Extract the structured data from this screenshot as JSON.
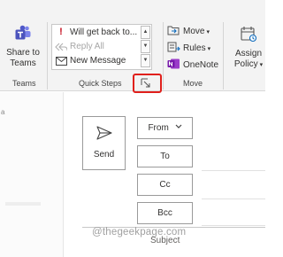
{
  "ribbon": {
    "teams": {
      "button_line1": "Share to",
      "button_line2": "Teams",
      "group_label": "Teams"
    },
    "quick_steps": {
      "items": [
        {
          "label": "Will get back to...",
          "icon": "exclamation-icon",
          "color": "#c50f1f"
        },
        {
          "label": "Reply All",
          "icon": "reply-all-icon",
          "disabled": true
        },
        {
          "label": "New Message",
          "icon": "envelope-icon"
        }
      ],
      "group_label": "Quick Steps"
    },
    "move": {
      "items": [
        {
          "label": "Move",
          "icon": "move-folder-icon"
        },
        {
          "label": "Rules",
          "icon": "rules-icon"
        },
        {
          "label": "OneNote",
          "icon": "onenote-icon",
          "color": "#7719aa"
        }
      ],
      "group_label": "Move"
    },
    "assign_policy": {
      "line1": "Assign",
      "line2": "Policy"
    }
  },
  "left_pane": {
    "glyph": "a"
  },
  "compose": {
    "send_label": "Send",
    "from_label": "From",
    "to_label": "To",
    "cc_label": "Cc",
    "bcc_label": "Bcc",
    "subject_label": "Subject"
  },
  "watermark": "@thegeekpage.com",
  "colors": {
    "highlight": "#e0201c",
    "teams": "#5059c9",
    "onenote": "#7719aa",
    "accent": "#0f6cbd"
  }
}
